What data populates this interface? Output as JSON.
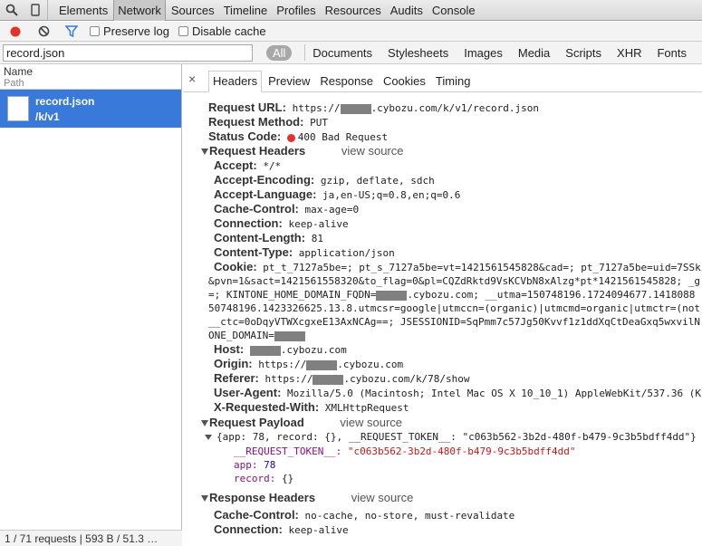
{
  "panel_tabs": [
    "Elements",
    "Network",
    "Sources",
    "Timeline",
    "Profiles",
    "Resources",
    "Audits",
    "Console"
  ],
  "active_panel": "Network",
  "toolbar": {
    "preserve_log": "Preserve log",
    "disable_cache": "Disable cache"
  },
  "filter": {
    "value": "record.json",
    "types": [
      "All",
      "Documents",
      "Stylesheets",
      "Images",
      "Media",
      "Scripts",
      "XHR",
      "Fonts"
    ]
  },
  "list": {
    "col_name": "Name",
    "col_path": "Path",
    "request_name": "record.json",
    "request_path": "/k/v1"
  },
  "status_bar": "1 / 71 requests | 593 B / 51.3 …",
  "detail_tabs": [
    "Headers",
    "Preview",
    "Response",
    "Cookies",
    "Timing"
  ],
  "general": {
    "url_label": "Request URL:",
    "url_pre": "https://",
    "url_post": ".cybozu.com/k/v1/record.json",
    "method_label": "Request Method:",
    "method": "PUT",
    "status_label": "Status Code:",
    "status": "400 Bad Request"
  },
  "sections": {
    "request_headers": "Request Headers",
    "request_payload": "Request Payload",
    "response_headers": "Response Headers",
    "view_source": "view source"
  },
  "request_headers": [
    {
      "k": "Accept:",
      "v": "*/*"
    },
    {
      "k": "Accept-Encoding:",
      "v": "gzip, deflate, sdch"
    },
    {
      "k": "Accept-Language:",
      "v": "ja,en-US;q=0.8,en;q=0.6"
    },
    {
      "k": "Cache-Control:",
      "v": "max-age=0"
    },
    {
      "k": "Connection:",
      "v": "keep-alive"
    },
    {
      "k": "Content-Length:",
      "v": "81"
    },
    {
      "k": "Content-Type:",
      "v": "application/json"
    }
  ],
  "cookie": {
    "label": "Cookie:",
    "l1": "pt_t_7127a5be=; pt_s_7127a5be=vt=1421561545828&cad=; pt_7127a5be=uid=7SSki",
    "l2": "&pvn=1&sact=1421561558320&to_flag=0&pl=CQZdRktd9VsKCVbN8xAlzg*pt*1421561545828; _g",
    "l3a": "=; KINTONE_HOME_DOMAIN_FQDN=",
    "l3b": ".cybozu.com; __utma=150748196.1724094677.1418088",
    "l4": "50748196.1423326625.13.8.utmcsr=google|utmccn=(organic)|utmcmd=organic|utmctr=(not",
    "l5": "__ctc=0oDqyVTWXcgxeE13AxNCAg==; JSESSIONID=SqPmm7c57Jg50Kvvf1z1ddXqCtDeaGxq5wxvilN",
    "l6": "ONE_DOMAIN="
  },
  "host": {
    "label": "Host:",
    "post": ".cybozu.com"
  },
  "origin": {
    "label": "Origin:",
    "pre": "https://",
    "post": ".cybozu.com"
  },
  "referer": {
    "label": "Referer:",
    "pre": "https://",
    "post": ".cybozu.com/k/78/show"
  },
  "user_agent": {
    "label": "User-Agent:",
    "v": "Mozilla/5.0 (Macintosh; Intel Mac OS X 10_10_1) AppleWebKit/537.36 (K"
  },
  "x_requested": {
    "label": "X-Requested-With:",
    "v": "XMLHttpRequest"
  },
  "payload": {
    "summary": "{app: 78, record: {}, __REQUEST_TOKEN__: \"c063b562-3b2d-480f-b479-9c3b5bdff4dd\"}",
    "token_key": "__REQUEST_TOKEN__:",
    "token_val": "\"c063b562-3b2d-480f-b479-9c3b5bdff4dd\"",
    "app_key": "app:",
    "app_val": "78",
    "record_key": "record:",
    "record_val": "{}"
  },
  "response_headers": [
    {
      "k": "Cache-Control:",
      "v": "no-cache, no-store, must-revalidate"
    },
    {
      "k": "Connection:",
      "v": "keep-alive"
    }
  ],
  "colors": {
    "selection": "#3879d9",
    "status_red": "#e2322d",
    "purple": "#881280",
    "string_red": "#c41a16"
  }
}
